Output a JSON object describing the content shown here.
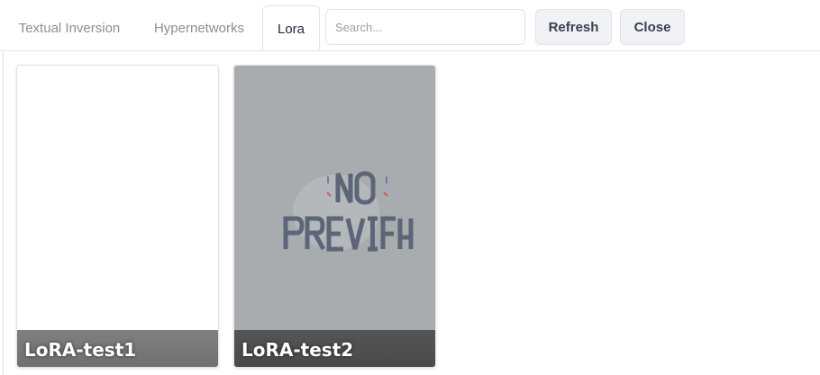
{
  "tabs": [
    {
      "label": "Textual Inversion",
      "active": false
    },
    {
      "label": "Hypernetworks",
      "active": false
    },
    {
      "label": "Lora",
      "active": true
    }
  ],
  "search": {
    "placeholder": "Search...",
    "value": ""
  },
  "buttons": {
    "refresh_label": "Refresh",
    "close_label": "Close"
  },
  "cards": [
    {
      "name": "LoRA-test1",
      "preview": "blank"
    },
    {
      "name": "LoRA-test2",
      "preview": "no-preview-image"
    }
  ],
  "colors": {
    "accent_border": "#e2e4e8",
    "card_overlay": "#a9acae",
    "no_preview_text": "#5d6678"
  }
}
